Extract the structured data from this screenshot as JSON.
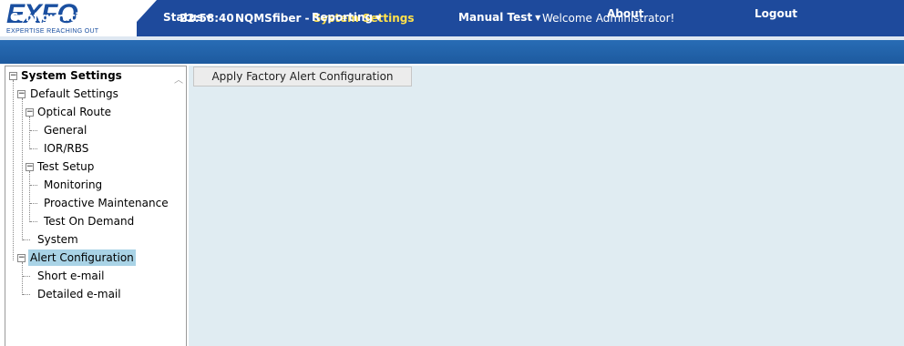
{
  "brand": {
    "logo_text": "EXFO",
    "tagline": "EXPERTISE REACHING OUT"
  },
  "header": {
    "time": "22:58:40",
    "app_name": "NQMSfiber",
    "separator": " - ",
    "page_name": "System Settings",
    "welcome": "Welcome Administrator!"
  },
  "nav": {
    "configuration": "Configuration",
    "status": "Status",
    "reporting": "Reporting",
    "manual_test": "Manual Test",
    "about": "About",
    "logout": "Logout",
    "caret_icon": "caret-down-icon"
  },
  "tree": {
    "root": "System Settings",
    "default_settings": "Default Settings",
    "optical_route": "Optical Route",
    "general": "General",
    "ior_rbs": "IOR/RBS",
    "test_setup": "Test Setup",
    "monitoring": "Monitoring",
    "proactive_maintenance": "Proactive Maintenance",
    "test_on_demand": "Test On Demand",
    "system": "System",
    "alert_configuration": "Alert Configuration",
    "short_email": "Short e-mail",
    "detailed_email": "Detailed e-mail",
    "selected": "Alert Configuration"
  },
  "content": {
    "apply_button": "Apply Factory Alert Configuration"
  },
  "colors": {
    "topbar": "#1e4a9c",
    "navbar": "#1d5a9f",
    "page_title": "#ffe14a",
    "content_bg": "#e0ecf2",
    "selection": "#a9d3e6"
  }
}
